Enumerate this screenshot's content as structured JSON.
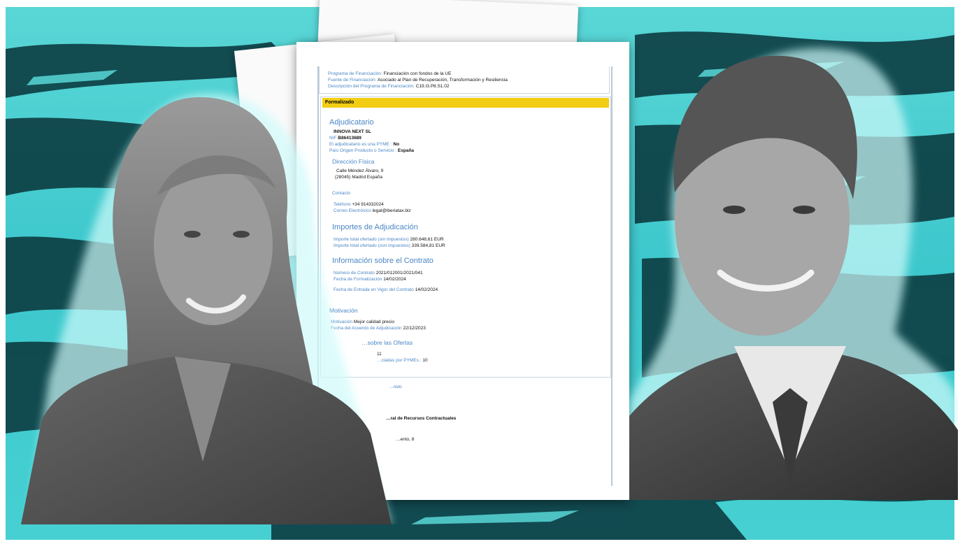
{
  "doc": {
    "funding": [
      {
        "label": "Programa de Financiación:",
        "value": "Financiación con fondos de la UE"
      },
      {
        "label": "Fuente de Financiación:",
        "value": "Asociado al Plan de Recuperación, Transformación y Resiliencia"
      },
      {
        "label": "Descripción del Programa de Financiación:",
        "value": "C19.I3.P8.S1.02"
      }
    ],
    "status": "Formalizado",
    "adjudicatario": {
      "heading": "Adjudicatario",
      "name": "INNOVA NEXT SL",
      "nif_label": "NIF",
      "nif": "B86413689",
      "pyme_label": "El adjudicatario es una PYME :",
      "pyme": "No",
      "origin_label": "País Origen Producto o Servicio :",
      "origin": "España"
    },
    "direccion": {
      "heading": "Dirección Física",
      "street": "Calle Méndez Álvaro, 9",
      "city": "(28045) Madrid España"
    },
    "contacto": {
      "heading": "Contacto",
      "phone_label": "Teléfono",
      "phone": "+34 914332024",
      "email_label": "Correo Electrónico",
      "email": "legal@iberiatax.biz"
    },
    "importes": {
      "heading": "Importes de Adjudicación",
      "rows": [
        {
          "label": "Importe total ofertado (sin impuestos)",
          "value": "280.648,61 EUR"
        },
        {
          "label": "Importe total ofertado (con impuestos)",
          "value": "339.584,81 EUR"
        }
      ]
    },
    "contrato": {
      "heading": "Información sobre el Contrato",
      "rows": [
        {
          "label": "Número de Contrato",
          "value": "2021/012001/2021/041"
        },
        {
          "label": "Fecha de Formalización",
          "value": "14/02/2024"
        },
        {
          "label": "Fecha de Entrada en Vigor del Contrato",
          "value": "14/02/2024"
        }
      ]
    },
    "motivacion": {
      "heading": "Motivación",
      "rows": [
        {
          "label": "Motivación",
          "value": "Mejor calidad precio"
        },
        {
          "label": "Fecha del Acuerdo de Adjudicación",
          "value": "22/12/2023"
        }
      ]
    },
    "ofertas": {
      "heading": "…sobre las Ofertas",
      "rows": [
        {
          "label": "",
          "value": "11"
        },
        {
          "label": "…ciadas por PYMEs :",
          "value": "10"
        }
      ]
    },
    "recurso": {
      "heading": "…nido",
      "body": "…ral de Recursos Contractuales",
      "street": "…ento, 8"
    }
  },
  "colors": {
    "background": "#3cc7cc",
    "status_bar": "#f3cd14",
    "label_blue": "#4a86c5"
  }
}
